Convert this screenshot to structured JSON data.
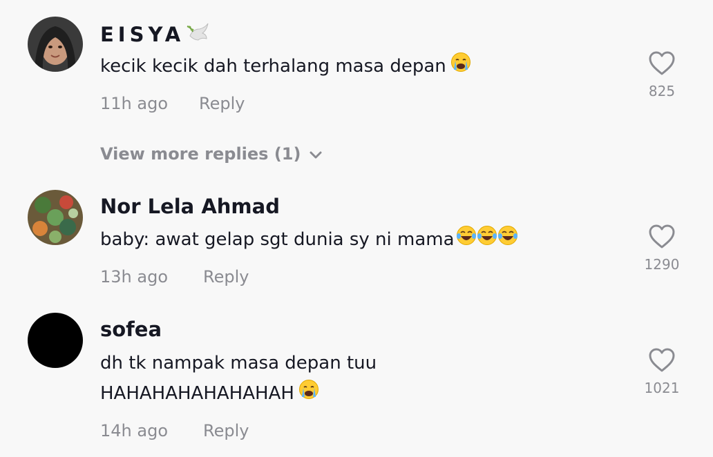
{
  "comments": [
    {
      "username": "EISYA",
      "username_icon": "dove-icon",
      "text": "kecik kecik dah terhalang masa depan",
      "text_emoji": [
        "loudly-crying-face"
      ],
      "time": "11h ago",
      "reply_label": "Reply",
      "likes": "825",
      "view_more": "View more replies (1)"
    },
    {
      "username": "Nor Lela Ahmad",
      "text": "baby: awat gelap sgt dunia sy ni mama",
      "text_emoji": [
        "face-with-tears-of-joy",
        "face-with-tears-of-joy",
        "face-with-tears-of-joy"
      ],
      "time": "13h ago",
      "reply_label": "Reply",
      "likes": "1290"
    },
    {
      "username": "sofea",
      "text_line1": "dh tk nampak masa depan tuu",
      "text_line2": "HAHAHAHAHAHAHAH",
      "text_emoji": [
        "loudly-crying-face"
      ],
      "time": "14h ago",
      "reply_label": "Reply",
      "likes": "1021"
    }
  ],
  "colors": {
    "background": "#f8f8f8",
    "primary_text": "#161823",
    "secondary_text": "#8a8b91"
  }
}
